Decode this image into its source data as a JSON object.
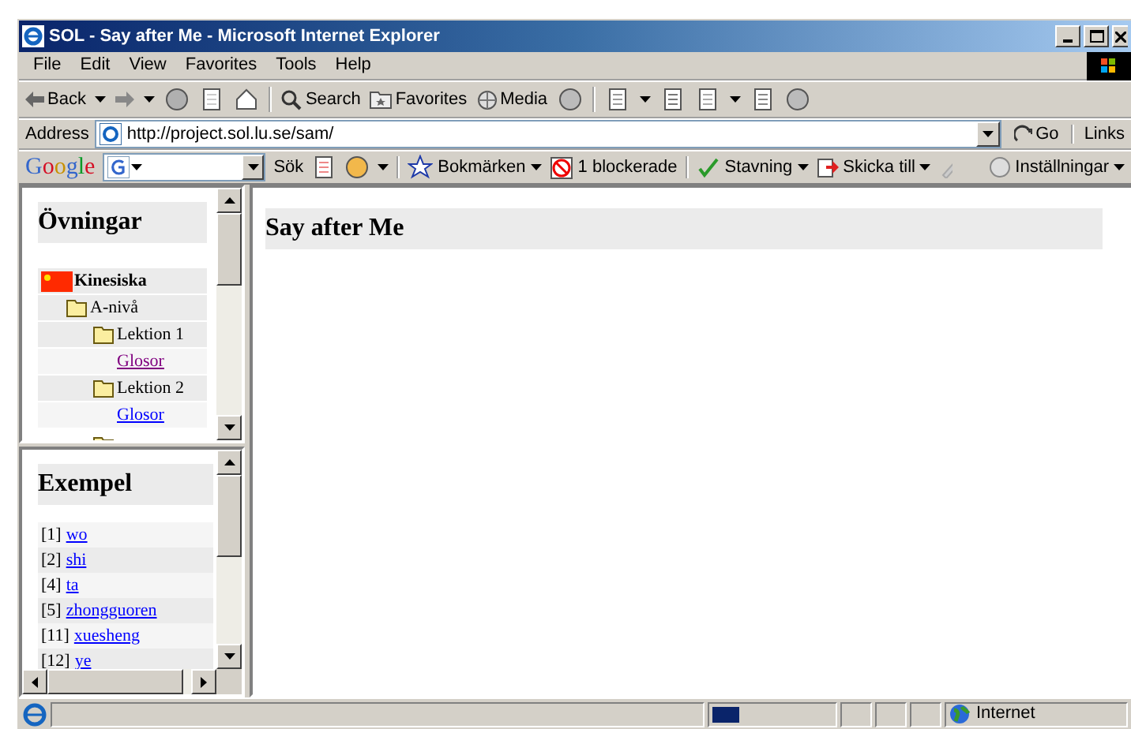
{
  "window": {
    "title": "SOL - Say after Me - Microsoft Internet Explorer"
  },
  "menu": [
    "File",
    "Edit",
    "View",
    "Favorites",
    "Tools",
    "Help"
  ],
  "toolbar": {
    "back": "Back",
    "search": "Search",
    "favorites": "Favorites",
    "media": "Media"
  },
  "address": {
    "label": "Address",
    "value": "http://project.sol.lu.se/sam/",
    "go": "Go",
    "links": "Links"
  },
  "google_bar": {
    "logo": "Google",
    "search": "Sök",
    "bookmarks": "Bokmärken",
    "blocked": "1 blockerade",
    "spelling": "Stavning",
    "send": "Skicka till",
    "settings": "Inställningar"
  },
  "exercises": {
    "title": "Övningar",
    "tree": [
      {
        "label": "Kinesiska",
        "kind": "language",
        "children": [
          {
            "label": "A-nivå",
            "kind": "folder",
            "children": [
              {
                "label": "Lektion 1",
                "kind": "folder",
                "children": [
                  {
                    "label": "Glosor",
                    "kind": "link",
                    "visited": true
                  }
                ]
              },
              {
                "label": "Lektion 2",
                "kind": "folder",
                "children": [
                  {
                    "label": "Glosor",
                    "kind": "link",
                    "visited": false
                  }
                ]
              }
            ]
          }
        ]
      }
    ]
  },
  "examples": {
    "title": "Exempel",
    "items": [
      {
        "number": "[1]",
        "word": "wo"
      },
      {
        "number": "[2]",
        "word": "shi"
      },
      {
        "number": "[4]",
        "word": "ta"
      },
      {
        "number": "[5]",
        "word": "zhongguoren"
      },
      {
        "number": "[11]",
        "word": "xuesheng"
      },
      {
        "number": "[12]",
        "word": "ye"
      }
    ]
  },
  "main": {
    "title": "Say after Me"
  },
  "status_bar": {
    "progress": {
      "level": 0.22
    },
    "zone": "Internet"
  }
}
